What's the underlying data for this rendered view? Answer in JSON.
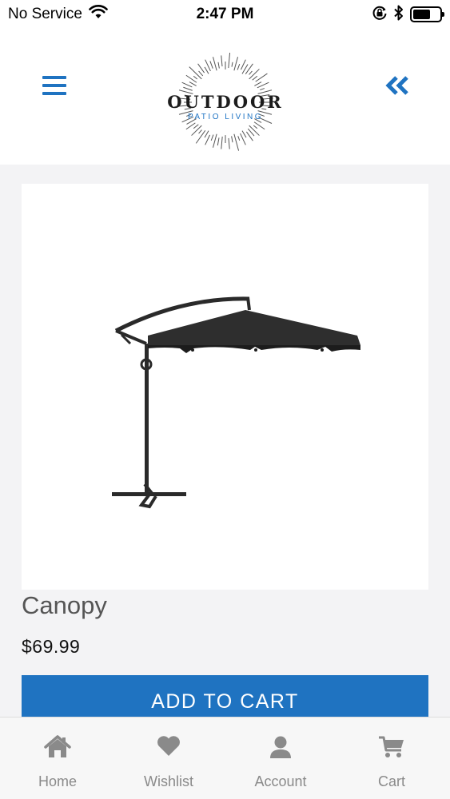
{
  "status_bar": {
    "carrier": "No Service",
    "time": "2:47 PM",
    "battery_level": 0.65
  },
  "header": {
    "logo": {
      "title": "OUTDOOR",
      "subtitle": "PATIO LIVING"
    },
    "menu_icon": "hamburger-menu-icon",
    "back_icon": "double-chevron-left-icon",
    "accent_color": "#1f73c1"
  },
  "product": {
    "name": "Canopy",
    "price": "$69.99",
    "add_to_cart_label": "ADD TO CART",
    "image": "cantilever-umbrella"
  },
  "tab_bar": {
    "tabs": [
      {
        "label": "Home",
        "icon": "home-icon"
      },
      {
        "label": "Wishlist",
        "icon": "heart-icon"
      },
      {
        "label": "Account",
        "icon": "user-icon"
      },
      {
        "label": "Cart",
        "icon": "cart-icon"
      }
    ],
    "inactive_color": "#8a8a8a"
  }
}
